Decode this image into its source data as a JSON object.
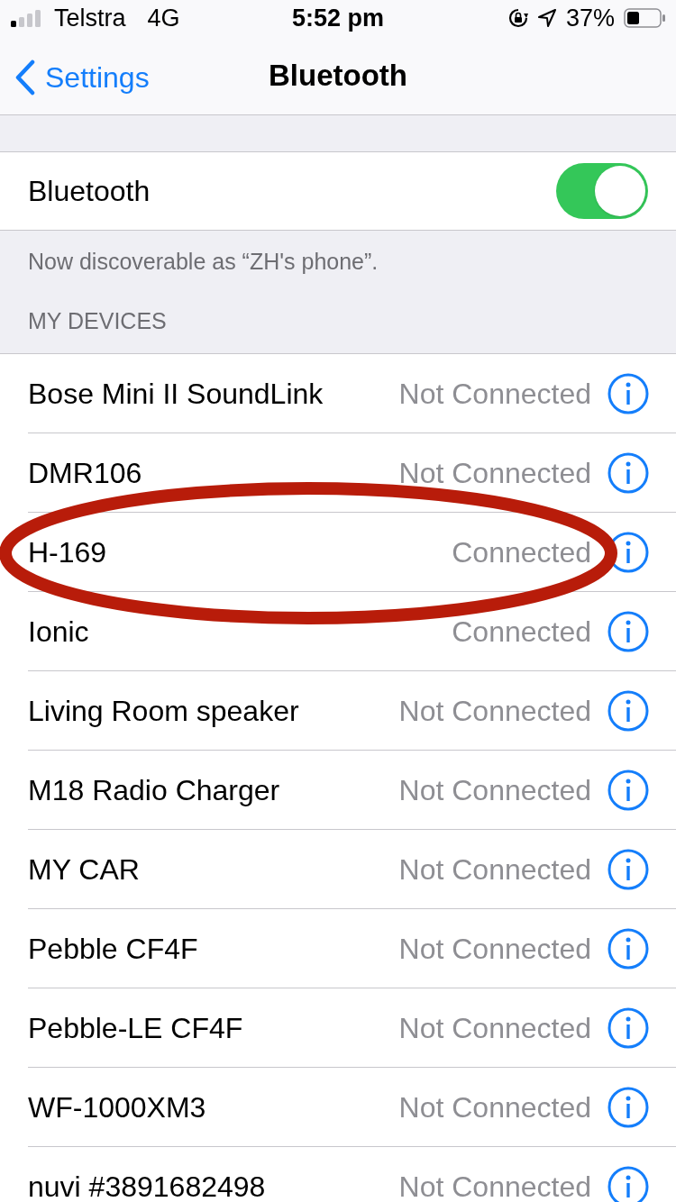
{
  "status_bar": {
    "carrier": "Telstra",
    "network": "4G",
    "time": "5:52 pm",
    "battery": "37%"
  },
  "nav": {
    "back": "Settings",
    "title": "Bluetooth"
  },
  "bluetooth": {
    "label": "Bluetooth",
    "on": true
  },
  "discoverable_note": "Now discoverable as “ZH's phone”.",
  "section_header": "MY DEVICES",
  "devices": [
    {
      "name": "Bose Mini II SoundLink",
      "status": "Not Connected"
    },
    {
      "name": "DMR106",
      "status": "Not Connected"
    },
    {
      "name": "H-169",
      "status": "Connected"
    },
    {
      "name": "Ionic",
      "status": "Connected"
    },
    {
      "name": "Living Room speaker",
      "status": "Not Connected"
    },
    {
      "name": "M18 Radio Charger",
      "status": "Not Connected"
    },
    {
      "name": "MY CAR",
      "status": "Not Connected"
    },
    {
      "name": "Pebble CF4F",
      "status": "Not Connected"
    },
    {
      "name": "Pebble-LE CF4F",
      "status": "Not Connected"
    },
    {
      "name": "WF-1000XM3",
      "status": "Not Connected"
    },
    {
      "name": "nuvi #3891682498",
      "status": "Not Connected"
    }
  ]
}
